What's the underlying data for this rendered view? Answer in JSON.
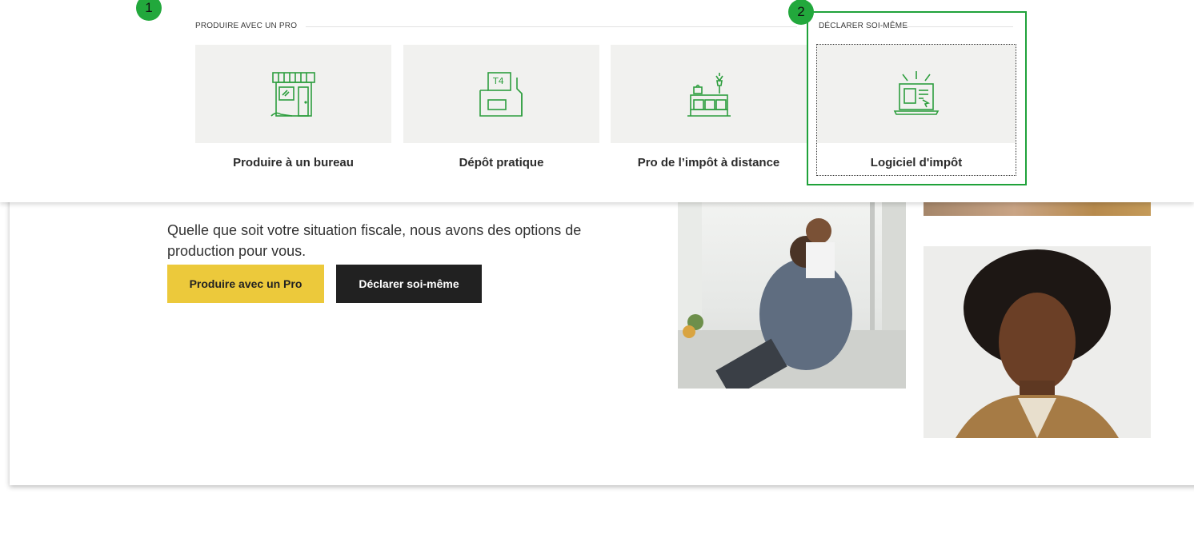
{
  "hero": {
    "description": "Quelle que soit votre situation fiscale, nous avons des options de production pour vous.",
    "primary_button": "Produire avec un Pro",
    "secondary_button": "Déclarer soi-même"
  },
  "dropdown": {
    "section_pro": "PRODUIRE AVEC UN PRO",
    "section_self": "DÉCLARER SOI-MÊME",
    "options": [
      {
        "label": "Produire à un bureau",
        "icon": "storefront-icon"
      },
      {
        "label": "Dépôt pratique",
        "icon": "t4-folder-icon",
        "icon_text": "T4"
      },
      {
        "label": "Pro de l’impôt à distance",
        "icon": "remote-desk-icon"
      },
      {
        "label": "Logiciel d'impôt",
        "icon": "laptop-software-icon"
      }
    ]
  },
  "annotations": {
    "badge_1": "1",
    "badge_2": "2"
  },
  "colors": {
    "accent_green": "#22a83c",
    "icon_green": "#2e9e3e",
    "primary_button_bg": "#ecc93b",
    "secondary_button_bg": "#212121",
    "tile_bg": "#f1f1ef"
  }
}
